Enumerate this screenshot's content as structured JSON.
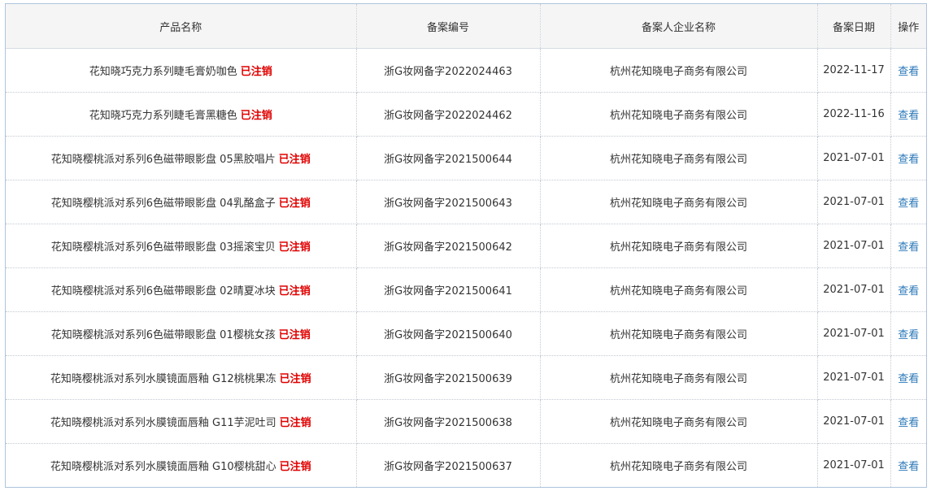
{
  "table": {
    "headers": {
      "product_name": "产品名称",
      "record_no": "备案编号",
      "company": "备案人企业名称",
      "date": "备案日期",
      "action": "操作"
    },
    "rows": [
      {
        "name": "花知晓巧克力系列睫毛膏奶咖色",
        "status": "已注销",
        "record_no": "浙G妆网备字2022024463",
        "company": "杭州花知晓电子商务有限公司",
        "date": "2022-11-17",
        "action": "查看"
      },
      {
        "name": "花知晓巧克力系列睫毛膏黑糖色",
        "status": "已注销",
        "record_no": "浙G妆网备字2022024462",
        "company": "杭州花知晓电子商务有限公司",
        "date": "2022-11-16",
        "action": "查看"
      },
      {
        "name": "花知晓樱桃派对系列6色磁带眼影盘 05黑胶唱片",
        "status": "已注销",
        "record_no": "浙G妆网备字2021500644",
        "company": "杭州花知晓电子商务有限公司",
        "date": "2021-07-01",
        "action": "查看"
      },
      {
        "name": "花知晓樱桃派对系列6色磁带眼影盘 04乳酪盒子",
        "status": "已注销",
        "record_no": "浙G妆网备字2021500643",
        "company": "杭州花知晓电子商务有限公司",
        "date": "2021-07-01",
        "action": "查看"
      },
      {
        "name": "花知晓樱桃派对系列6色磁带眼影盘 03摇滚宝贝",
        "status": "已注销",
        "record_no": "浙G妆网备字2021500642",
        "company": "杭州花知晓电子商务有限公司",
        "date": "2021-07-01",
        "action": "查看"
      },
      {
        "name": "花知晓樱桃派对系列6色磁带眼影盘 02晴夏冰块",
        "status": "已注销",
        "record_no": "浙G妆网备字2021500641",
        "company": "杭州花知晓电子商务有限公司",
        "date": "2021-07-01",
        "action": "查看"
      },
      {
        "name": "花知晓樱桃派对系列6色磁带眼影盘 01樱桃女孩",
        "status": "已注销",
        "record_no": "浙G妆网备字2021500640",
        "company": "杭州花知晓电子商务有限公司",
        "date": "2021-07-01",
        "action": "查看"
      },
      {
        "name": "花知晓樱桃派对系列水膜镜面唇釉 G12桃桃果冻",
        "status": "已注销",
        "record_no": "浙G妆网备字2021500639",
        "company": "杭州花知晓电子商务有限公司",
        "date": "2021-07-01",
        "action": "查看"
      },
      {
        "name": "花知晓樱桃派对系列水膜镜面唇釉 G11芋泥吐司",
        "status": "已注销",
        "record_no": "浙G妆网备字2021500638",
        "company": "杭州花知晓电子商务有限公司",
        "date": "2021-07-01",
        "action": "查看"
      },
      {
        "name": "花知晓樱桃派对系列水膜镜面唇釉 G10樱桃甜心",
        "status": "已注销",
        "record_no": "浙G妆网备字2021500637",
        "company": "杭州花知晓电子商务有限公司",
        "date": "2021-07-01",
        "action": "查看"
      }
    ]
  },
  "colors": {
    "status_red": "#e00000",
    "link_blue": "#2b78b8",
    "header_bg": "#f5f5f5",
    "border": "#aec3dc"
  }
}
